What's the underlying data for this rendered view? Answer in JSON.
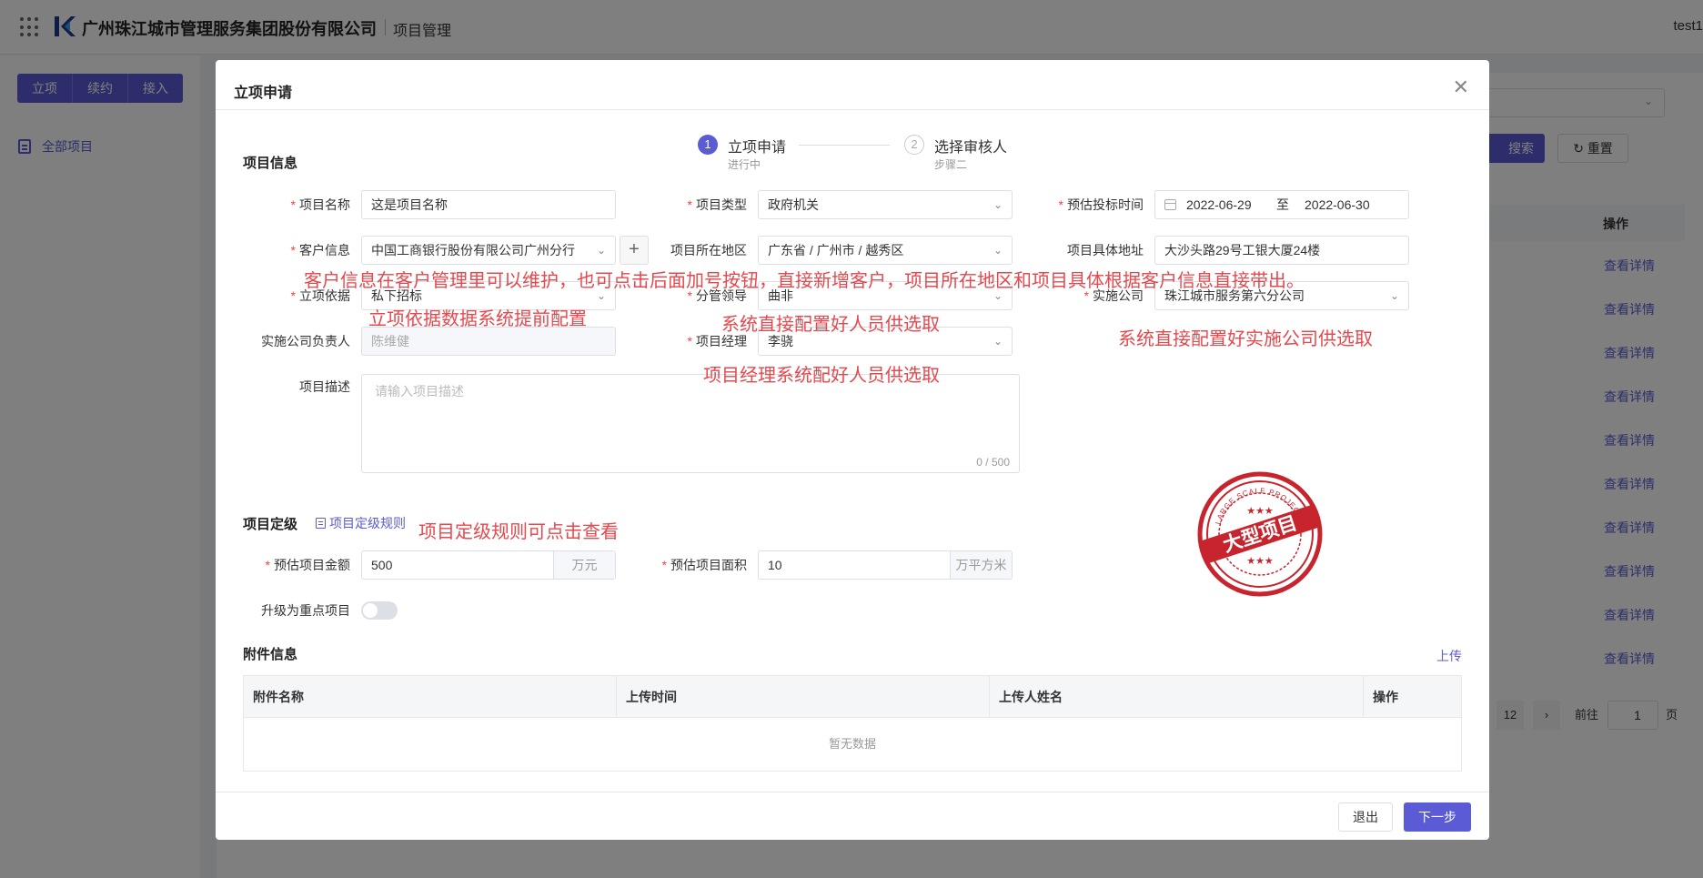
{
  "header": {
    "company": "广州珠江城市管理服务集团股份有限公司",
    "module": "项目管理",
    "user": "test1"
  },
  "sidebar": {
    "buttons": [
      "立项",
      "续约",
      "接入"
    ],
    "all_projects": "全部项目"
  },
  "background": {
    "search_label": "搜索",
    "reset_label": "重置",
    "op_column": "操作",
    "row_link": "查看详情",
    "row_count": 10,
    "pager": {
      "page": "12",
      "goto_label": "前往",
      "goto_value": "1",
      "page_unit": "页"
    }
  },
  "dialog": {
    "title": "立项申请",
    "steps": [
      {
        "num": "1",
        "title": "立项申请",
        "desc": "进行中"
      },
      {
        "num": "2",
        "title": "选择审核人",
        "desc": "步骤二"
      }
    ],
    "section_project_info": "项目信息",
    "fields": {
      "project_name": {
        "label": "项目名称",
        "value": "这是项目名称"
      },
      "project_type": {
        "label": "项目类型",
        "value": "政府机关"
      },
      "bid_time": {
        "label": "预估投标时间",
        "start": "2022-06-29",
        "sep": "至",
        "end": "2022-06-30"
      },
      "customer": {
        "label": "客户信息",
        "value": "中国工商银行股份有限公司广州分行"
      },
      "region": {
        "label": "项目所在地区",
        "value": "广东省 / 广州市 / 越秀区"
      },
      "address": {
        "label": "项目具体地址",
        "value": "大沙头路29号工银大厦24楼"
      },
      "basis": {
        "label": "立项依据",
        "value": "私下招标"
      },
      "leader": {
        "label": "分管领导",
        "value": "曲非"
      },
      "company": {
        "label": "实施公司",
        "value": "珠江城市服务第六分公司"
      },
      "company_head": {
        "label": "实施公司负责人",
        "value": "陈维健"
      },
      "manager": {
        "label": "项目经理",
        "value": "李骁"
      },
      "description": {
        "label": "项目描述",
        "placeholder": "请输入项目描述",
        "count": "0 / 500"
      }
    },
    "section_grading": "项目定级",
    "grading_rule_link": "项目定级规则",
    "amount": {
      "label": "预估项目金额",
      "value": "500",
      "unit": "万元"
    },
    "area": {
      "label": "预估项目面积",
      "value": "10",
      "unit": "万平方米"
    },
    "key_project": {
      "label": "升级为重点项目",
      "on": false
    },
    "section_attachments": "附件信息",
    "upload_label": "上传",
    "attachment_columns": [
      "附件名称",
      "上传时间",
      "上传人姓名",
      "操作"
    ],
    "attachment_empty": "暂无数据",
    "exit_label": "退出",
    "next_label": "下一步"
  },
  "annotations": {
    "customer_note": "客户信息在客户管理里可以维护，也可点击后面加号按钮，直接新增客户，项目所在地区和项目具体根据客户信息直接带出。",
    "basis_note": "立项依据数据系统提前配置",
    "leader_note": "系统直接配置好人员供选取",
    "company_note": "系统直接配置好实施公司供选取",
    "manager_note": "项目经理系统配好人员供选取",
    "rule_note": "项目定级规则可点击查看"
  },
  "stamp": {
    "text": "大型项目",
    "ring_top": "LARGE SCALE PROJECTS",
    "stars": "★★★"
  },
  "colors": {
    "accent": "#5b5bd6",
    "annotation": "#e5484d",
    "required": "#e5484d"
  }
}
